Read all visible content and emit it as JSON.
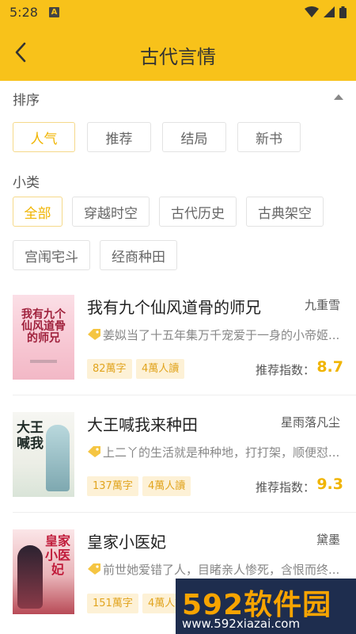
{
  "status_bar": {
    "time": "5:28",
    "notification_icon": "A"
  },
  "header": {
    "title": "古代言情"
  },
  "filters": {
    "sort_label": "排序",
    "sort_options": [
      "人气",
      "推荐",
      "结局",
      "新书"
    ],
    "sort_active": 0,
    "category_label": "小类",
    "category_options": [
      "全部",
      "穿越时空",
      "古代历史",
      "古典架空",
      "宫闱宅斗",
      "经商种田"
    ],
    "category_active": 0
  },
  "books": [
    {
      "title": "我有九个仙风道骨的师兄",
      "author": "九重雪",
      "description": "姜姒当了十五年集万千宠爱于一身的小帝姬...",
      "word_count": "82萬字",
      "readers": "4萬人讀",
      "score_label": "推荐指数：",
      "score": "8.7",
      "cover_text": "我有九个仙风道骨的师兄"
    },
    {
      "title": "大王喊我来种田",
      "author": "星雨落凡尘",
      "description": "上二丫的生活就是种种地，打打架，顺便怼...",
      "word_count": "137萬字",
      "readers": "4萬人讀",
      "score_label": "推荐指数：",
      "score": "9.3",
      "cover_text": "大王喊我"
    },
    {
      "title": "皇家小医妃",
      "author": "黛墨",
      "description": "前世她爱错了人，目睹亲人惨死，含恨而终...",
      "word_count": "151萬字",
      "readers": "4萬人讀",
      "score_label": "推荐指数：",
      "score": "",
      "cover_text": "皇家小医妃"
    }
  ],
  "watermark": {
    "main": "592软件园",
    "sub": "www.592xiazai.com"
  },
  "colors": {
    "accent": "#f8c21a",
    "active_tag": "#f0b400",
    "badge_bg": "#fdf1d6"
  },
  "icons": [
    "back-arrow-icon",
    "wifi-icon",
    "signal-icon",
    "battery-icon",
    "collapse-arrow-icon",
    "tag-icon"
  ]
}
